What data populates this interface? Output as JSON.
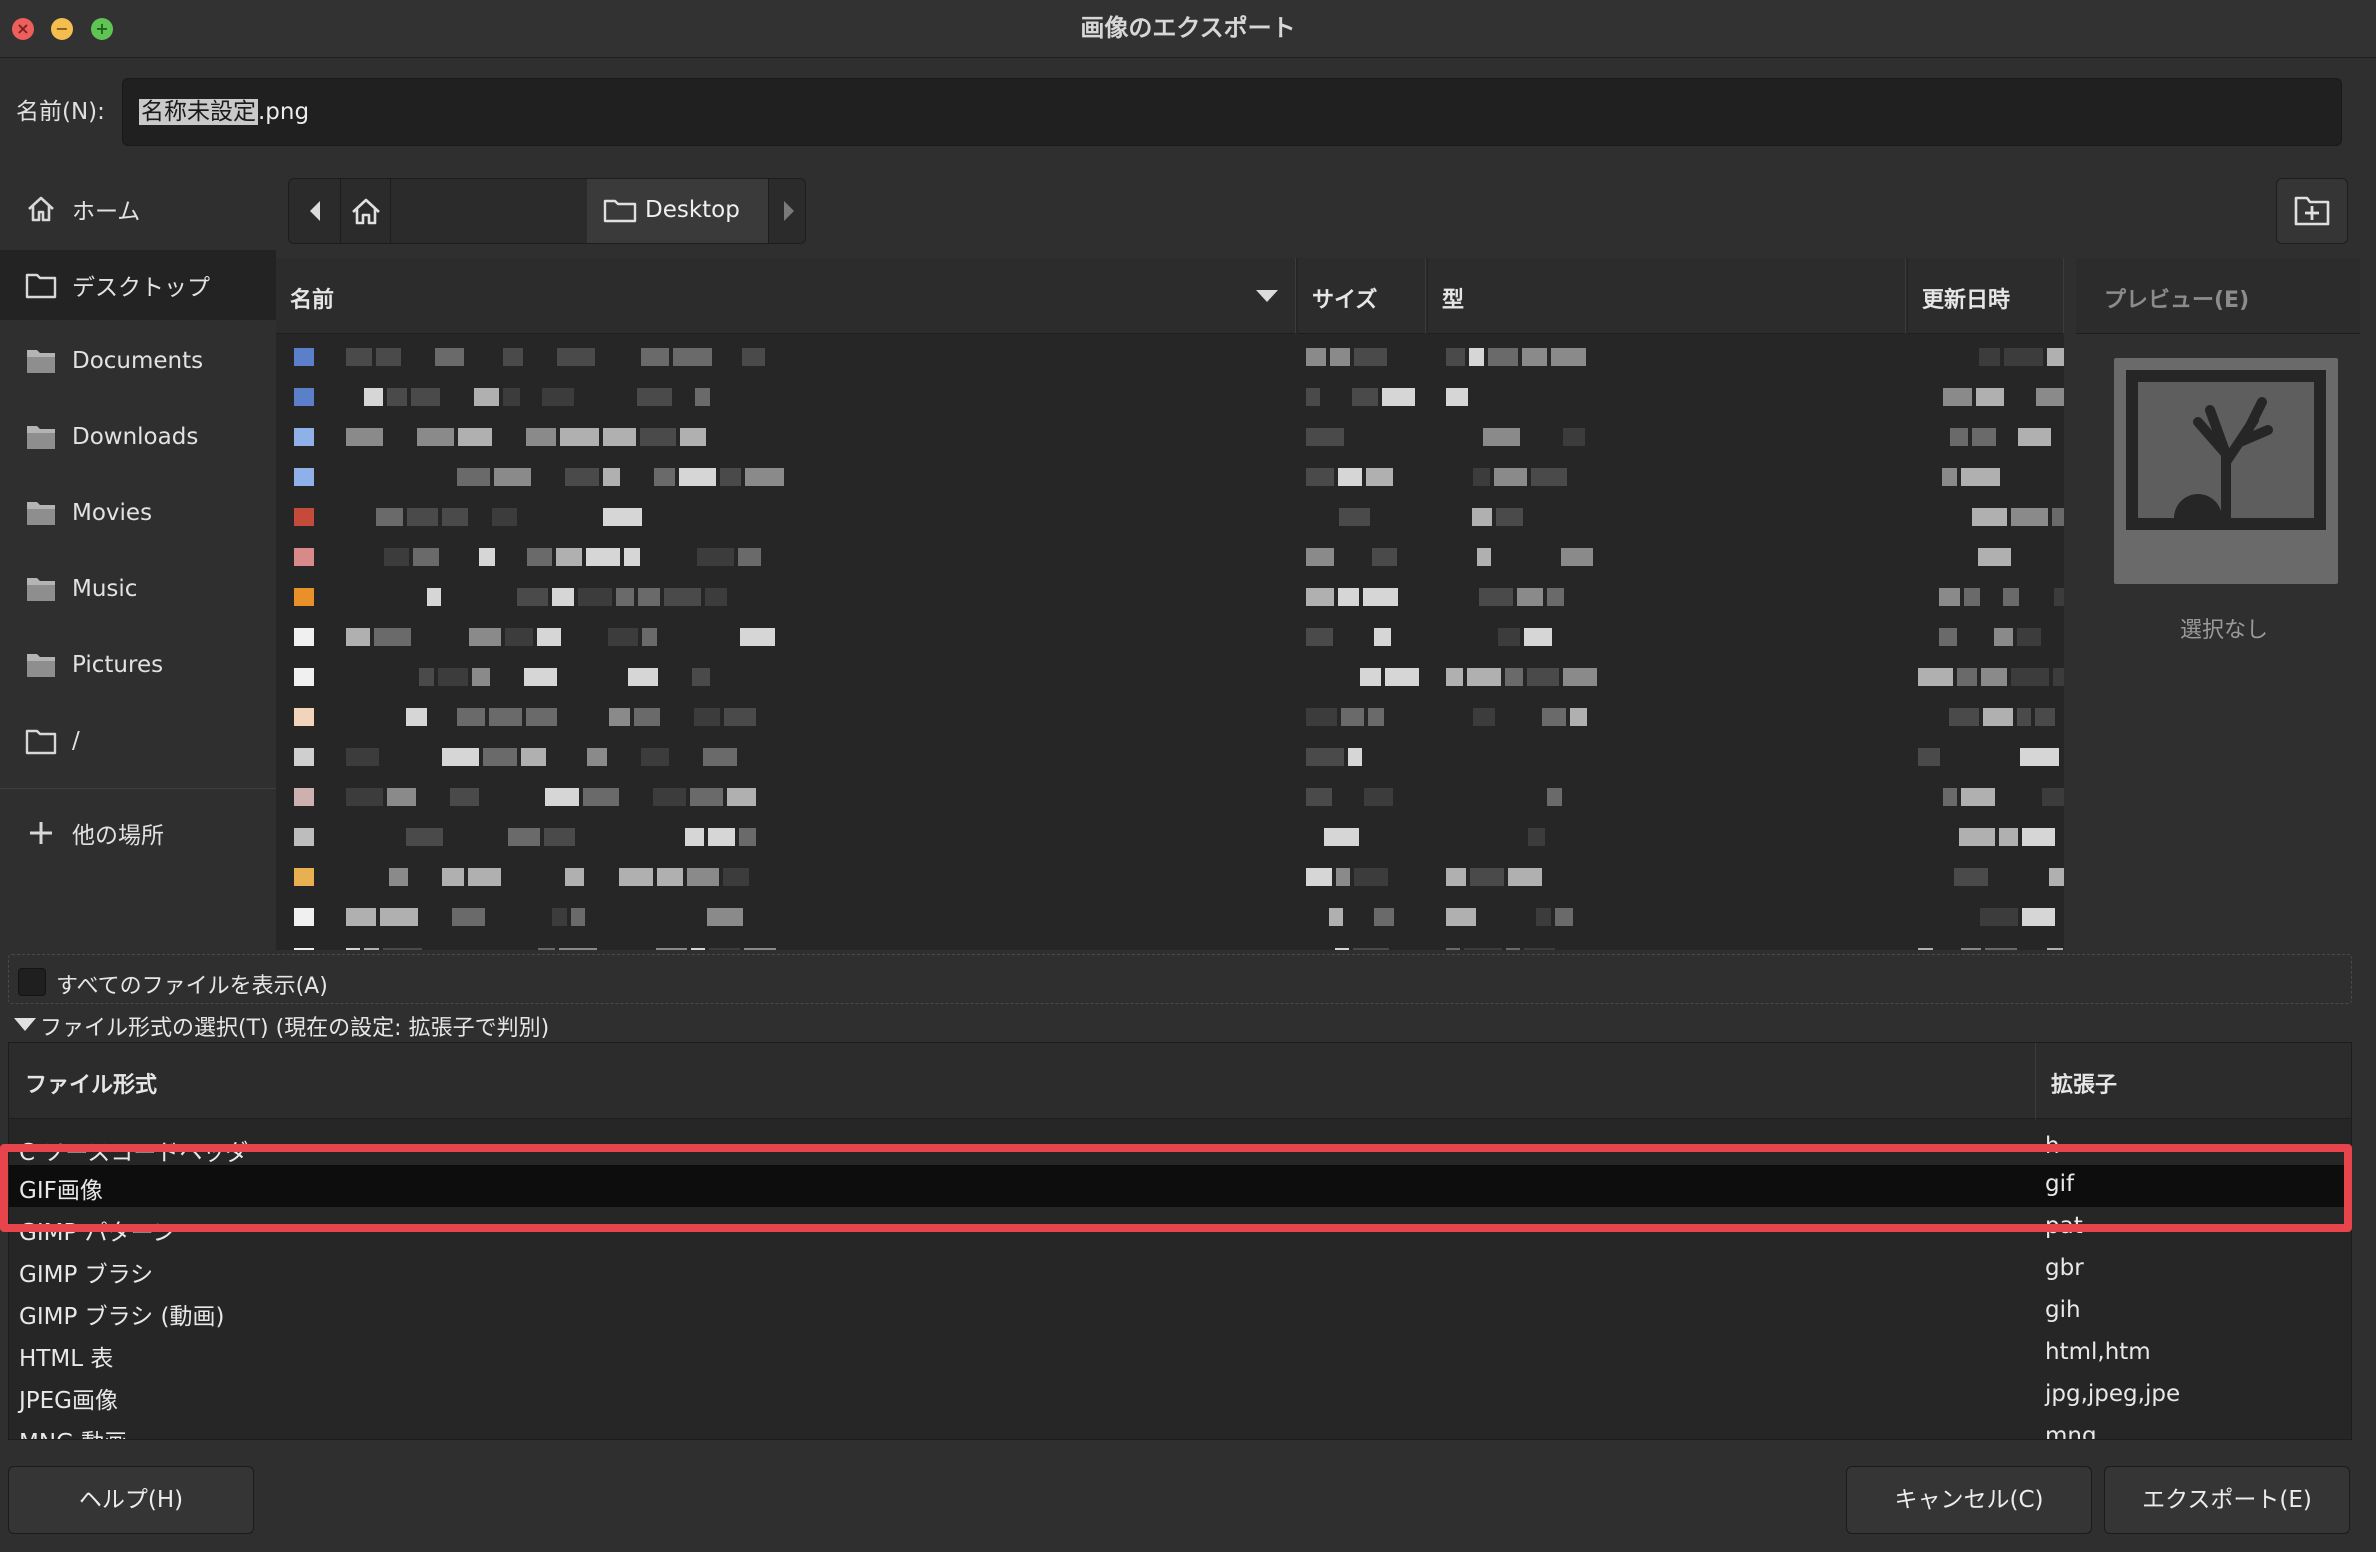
{
  "window": {
    "title": "画像のエクスポート"
  },
  "name_row": {
    "label": "名前(N):",
    "value_selected": "名称未設定",
    "value_suffix": ".png"
  },
  "sidebar": {
    "items": [
      {
        "label": "ホーム",
        "icon": "home-icon"
      },
      {
        "label": "デスクトップ",
        "icon": "folder-icon"
      },
      {
        "label": "Documents",
        "icon": "folder-icon"
      },
      {
        "label": "Downloads",
        "icon": "folder-icon"
      },
      {
        "label": "Movies",
        "icon": "folder-icon"
      },
      {
        "label": "Music",
        "icon": "folder-icon"
      },
      {
        "label": "Pictures",
        "icon": "folder-icon"
      },
      {
        "label": "/",
        "icon": "folder-icon"
      },
      {
        "label": "他の場所",
        "icon": "plus-icon"
      }
    ]
  },
  "pathbar": {
    "current": "Desktop"
  },
  "file_list": {
    "columns": {
      "name": "名前",
      "size": "サイズ",
      "type": "型",
      "modified": "更新日時"
    }
  },
  "preview": {
    "header": "プレビュー(E)",
    "empty_text": "選択なし"
  },
  "options": {
    "show_all": "すべてのファイルを表示(A)",
    "format_expander": "ファイル形式の選択(T) (現在の設定: 拡張子で判別)"
  },
  "format_table": {
    "headers": {
      "format": "ファイル形式",
      "extension": "拡張子"
    },
    "rows": [
      {
        "name": "C ソースコードヘッダ",
        "ext": "h"
      },
      {
        "name": "GIF画像",
        "ext": "gif"
      },
      {
        "name": "GIMP パターン",
        "ext": "pat"
      },
      {
        "name": "GIMP ブラシ",
        "ext": "gbr"
      },
      {
        "name": "GIMP ブラシ (動画)",
        "ext": "gih"
      },
      {
        "name": "HTML 表",
        "ext": "html,htm"
      },
      {
        "name": "JPEG画像",
        "ext": "jpg,jpeg,jpe"
      },
      {
        "name": "MNG 動画",
        "ext": "mng"
      }
    ]
  },
  "buttons": {
    "help": "ヘルプ(H)",
    "cancel": "キャンセル(C)",
    "export": "エクスポート(E)"
  }
}
